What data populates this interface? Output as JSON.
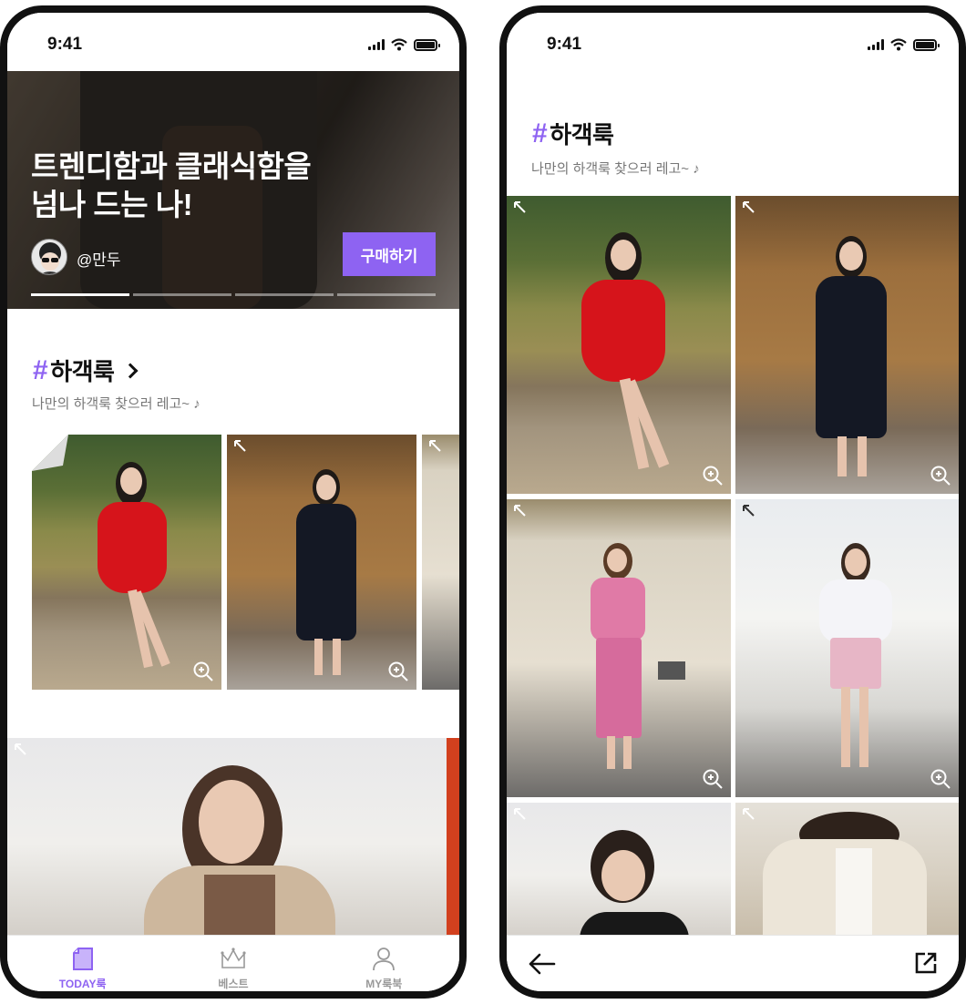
{
  "left_screen": {
    "status_bar": {
      "time": "9:41"
    },
    "hero": {
      "title": "트렌디함과 클래식함을\n넘나 드는 나!",
      "user": "@만두",
      "buy_button": "구매하기"
    },
    "section": {
      "hash": "#",
      "title": "하객룩",
      "subtitle": "나만의 하객룩 찾으러 레고~ ♪"
    },
    "tabbar": [
      {
        "label": "TODAY룩",
        "icon": "document-icon",
        "active": true
      },
      {
        "label": "베스트",
        "icon": "crown-icon",
        "active": false
      },
      {
        "label": "MY룩북",
        "icon": "person-icon",
        "active": false
      }
    ]
  },
  "right_screen": {
    "status_bar": {
      "time": "9:41"
    },
    "section": {
      "hash": "#",
      "title": "하객룩",
      "subtitle": "나만의 하객룩 찾으러 레고~ ♪"
    },
    "nav": {
      "back_icon": "back-arrow-icon",
      "share_icon": "share-icon"
    }
  },
  "colors": {
    "accent": "#8e63f2",
    "text": "#111111",
    "subtext": "#777777"
  }
}
